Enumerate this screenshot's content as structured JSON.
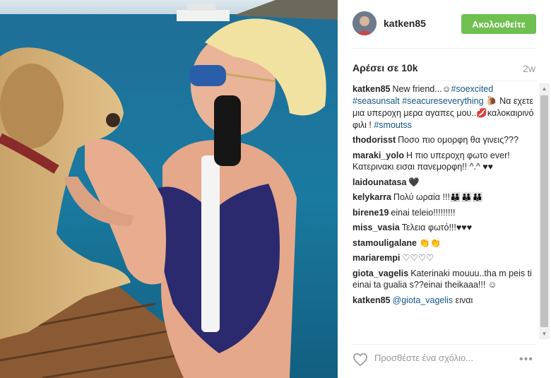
{
  "post": {
    "username": "katken85",
    "follow_label": "Ακολουθείτε",
    "likes": "Αρέσει σε 10k",
    "time": "2w"
  },
  "caption": {
    "user": "katken85",
    "text1": "New friend...",
    "tag1": "#soexcited",
    "tag2": "#seasunsalt",
    "tag3": "#seacureseverything",
    "text2": "Να εχετε μια υπεροχη μερα αγαπες μου..",
    "text3": "καλοκαιρινό φιλι !",
    "tag4": "#smoutss"
  },
  "comments": [
    {
      "user": "thodorisst",
      "text": "Ποσο πιο ομορφη θα γινεις???"
    },
    {
      "user": "maraki_yolo",
      "text": "Η πιο υπεροχη φωτο ever! Κατερινακι εισαι πανεμορφη!! ^.^ ♥♥"
    },
    {
      "user": "laidounatasa",
      "text": "🖤"
    },
    {
      "user": "kelykarra",
      "text": "Πολύ ωραία !!!"
    },
    {
      "user": "birene19",
      "text": "einai teleio!!!!!!!!!"
    },
    {
      "user": "miss_vasia",
      "text": "Τελεια φωτό!!!"
    },
    {
      "user": "stamouligalane",
      "text": ""
    },
    {
      "user": "mariarempi",
      "text": "♡♡♡♡"
    },
    {
      "user": "giota_vagelis",
      "text": "Katerinaki mouuu..tha m peis ti einai ta gualia s??einai theikaaa!!! ☺"
    },
    {
      "user": "katken85",
      "mention": "@giota_vagelis",
      "text": "ειναι"
    }
  ],
  "footer": {
    "placeholder": "Προσθέστε ένα σχόλιο...",
    "more": "•••"
  },
  "colors": {
    "follow": "#70c050",
    "hashtag": "#125688"
  },
  "icons": [
    "heart-icon",
    "more-options-icon",
    "avatar",
    "scroll-up-arrow",
    "scroll-down-arrow"
  ]
}
